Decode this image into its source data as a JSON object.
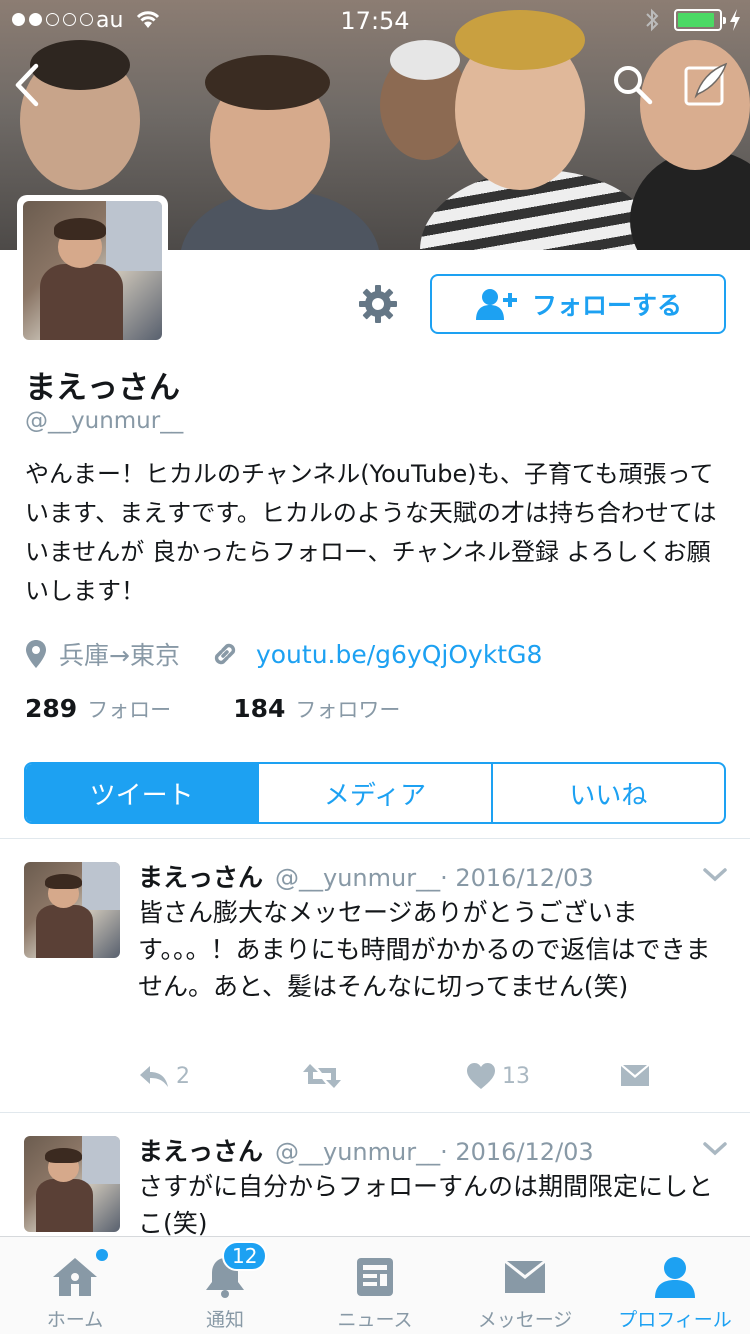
{
  "status_bar": {
    "carrier": "au",
    "time": "17:54",
    "signal_bars_filled": 2,
    "signal_bars_total": 5
  },
  "profile": {
    "name": "まえっさん",
    "handle": "@__yunmur__",
    "bio": "やんまー！ヒカルのチャンネル(YouTube)も、子育ても頑張っています、まえすです。ヒカルのような天賦の才は持ち合わせてはいませんが 良かったらフォロー、チャンネル登録 よろしくお願いします！",
    "location": "兵庫→東京",
    "url": "youtu.be/g6yQjOyktG8",
    "following_count": "289",
    "following_label": "フォロー",
    "followers_count": "184",
    "followers_label": "フォロワー",
    "follow_button_label": "フォローする"
  },
  "tabs": [
    {
      "label": "ツイート",
      "active": true
    },
    {
      "label": "メディア",
      "active": false
    },
    {
      "label": "いいね",
      "active": false
    }
  ],
  "tweets": [
    {
      "name": "まえっさん",
      "handle": "@__yunmur__",
      "date": " · 2016/12/03",
      "text": "皆さん膨大なメッセージありがとうございます。。。！あまりにも時間がかかるので返信はできません。あと、髪はそんなに切ってません(笑)",
      "replies": "2",
      "retweets": "",
      "likes": "13"
    },
    {
      "name": "まえっさん",
      "handle": "@__yunmur__",
      "date": " · 2016/12/03",
      "text": "さすがに自分からフォローすんのは期間限定にしとこ(笑)"
    }
  ],
  "bottom_nav": [
    {
      "label": "ホーム",
      "icon": "home-icon",
      "active": false
    },
    {
      "label": "通知",
      "icon": "bell-icon",
      "badge": "12",
      "active": false
    },
    {
      "label": "ニュース",
      "icon": "news-icon",
      "active": false
    },
    {
      "label": "メッセージ",
      "icon": "envelope-icon",
      "active": false
    },
    {
      "label": "プロフィール",
      "icon": "person-icon",
      "active": true
    }
  ],
  "colors": {
    "accent": "#1da1f2",
    "muted": "#8899a6",
    "text": "#14171a",
    "battery": "#4cd964"
  }
}
